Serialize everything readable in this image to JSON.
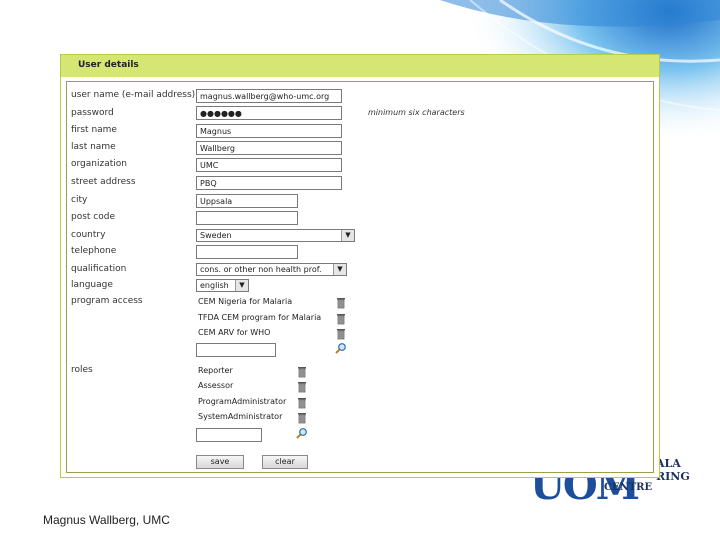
{
  "panel": {
    "title": "User details"
  },
  "fields": {
    "username": {
      "label": "user name (e-mail address)",
      "value": "magnus.wallberg@who-umc.org"
    },
    "password": {
      "label": "password",
      "value": "●●●●●●",
      "hint": "minimum six characters"
    },
    "first_name": {
      "label": "first name",
      "value": "Magnus"
    },
    "last_name": {
      "label": "last name",
      "value": "Wallberg"
    },
    "organization": {
      "label": "organization",
      "value": "UMC"
    },
    "street_address": {
      "label": "street address",
      "value": "PBQ"
    },
    "city": {
      "label": "city",
      "value": "Uppsala"
    },
    "post_code": {
      "label": "post code",
      "value": ""
    },
    "country": {
      "label": "country",
      "value": "Sweden"
    },
    "telephone": {
      "label": "telephone",
      "value": ""
    },
    "qualification": {
      "label": "qualification",
      "value": "cons. or other non health prof."
    },
    "language": {
      "label": "language",
      "value": "english"
    }
  },
  "program_access": {
    "label": "program access",
    "items": [
      "CEM Nigeria for Malaria",
      "TFDA CEM program for Malaria",
      "CEM ARV for WHO"
    ],
    "new_value": ""
  },
  "roles": {
    "label": "roles",
    "items": [
      "Reporter",
      "Assessor",
      "ProgramAdministrator",
      "SystemAdministrator"
    ],
    "new_value": ""
  },
  "buttons": {
    "save": "save",
    "clear": "clear"
  },
  "footer": {
    "author": "Magnus Wallberg, UMC"
  },
  "logo": {
    "big": "UOM",
    "line1": "ALA",
    "line2": "RING",
    "line3": "CENTRE"
  },
  "colors": {
    "header_green": "#d6e672",
    "panel_border": "#b8cc4a",
    "swirl_blue": "#4aa8e6"
  }
}
